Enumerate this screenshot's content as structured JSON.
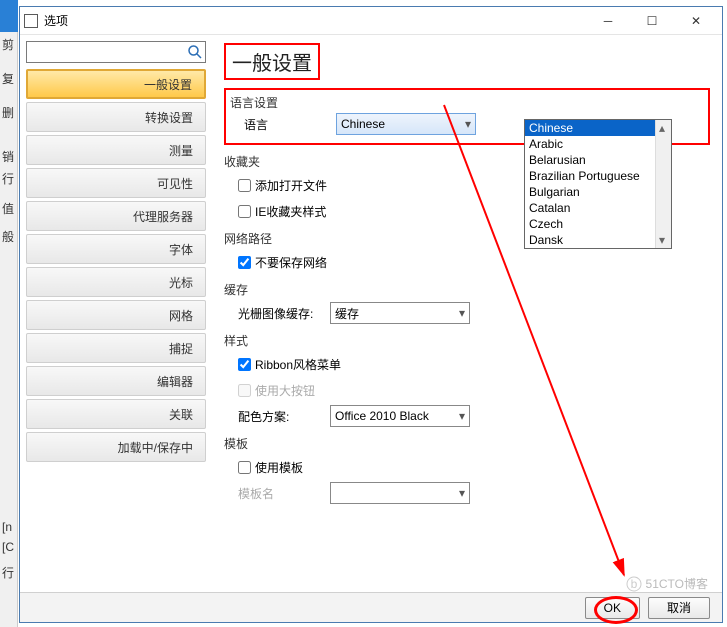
{
  "window": {
    "title": "选项"
  },
  "leftStrip": {
    "items": [
      "剪",
      "复",
      "删",
      "销",
      "行",
      "值",
      "般",
      "[n",
      "[C",
      "行"
    ]
  },
  "sidebar": {
    "search_placeholder": "",
    "items": [
      {
        "label": "一般设置"
      },
      {
        "label": "转换设置"
      },
      {
        "label": "测量"
      },
      {
        "label": "可见性"
      },
      {
        "label": "代理服务器"
      },
      {
        "label": "字体"
      },
      {
        "label": "光标"
      },
      {
        "label": "网格"
      },
      {
        "label": "捕捉"
      },
      {
        "label": "编辑器"
      },
      {
        "label": "关联"
      },
      {
        "label": "加载中/保存中"
      }
    ]
  },
  "content": {
    "title": "一般设置",
    "lang": {
      "group": "语言设置",
      "label": "语言",
      "value": "Chinese",
      "options": [
        "Chinese",
        "Arabic",
        "Belarusian",
        "Brazilian Portuguese",
        "Bulgarian",
        "Catalan",
        "Czech",
        "Dansk"
      ]
    },
    "favorites": {
      "group": "收藏夹",
      "cb1": "添加打开文件",
      "cb2": "IE收藏夹样式"
    },
    "network": {
      "group": "网络路径",
      "cb": "不要保存网络"
    },
    "cache": {
      "group": "缓存",
      "label": "光栅图像缓存:",
      "value": "缓存"
    },
    "style": {
      "group": "样式",
      "cb1": "Ribbon风格菜单",
      "cb2": "使用大按钮",
      "scheme_label": "配色方案:",
      "scheme_value": "Office 2010 Black"
    },
    "template": {
      "group": "模板",
      "cb": "使用模板",
      "name_label": "模板名"
    }
  },
  "footer": {
    "ok": "OK",
    "cancel": "取消"
  },
  "watermark": "51CTO博客"
}
